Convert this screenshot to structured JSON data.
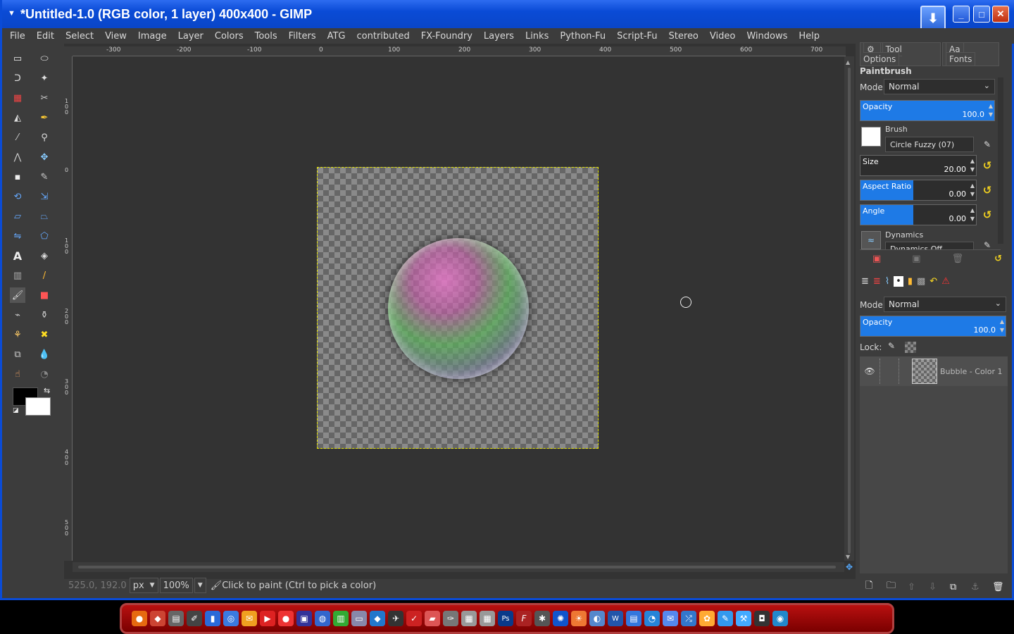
{
  "window": {
    "title": "*Untitled-1.0 (RGB color, 1 layer) 400x400 - GIMP",
    "minimize_glyph": "_",
    "maximize_glyph": "□",
    "close_glyph": "✕"
  },
  "menubar": [
    "File",
    "Edit",
    "Select",
    "View",
    "Image",
    "Layer",
    "Colors",
    "Tools",
    "Filters",
    "ATG",
    "contributed",
    "FX-Foundry",
    "Layers",
    "Links",
    "Python-Fu",
    "Script-Fu",
    "Stereo",
    "Video",
    "Windows",
    "Help"
  ],
  "ruler": {
    "h_ticks": [
      "-300",
      "-200",
      "-100",
      "0",
      "100",
      "200",
      "300",
      "400",
      "500",
      "600",
      "700"
    ],
    "v_ticks": [
      "100",
      "0",
      "100",
      "200",
      "300",
      "400",
      "500"
    ]
  },
  "statusbar": {
    "coords": "525.0, 192.0",
    "unit": "px",
    "zoom": "100",
    "zoom_suffix": "%",
    "message": "Click to paint (Ctrl to pick a color)"
  },
  "tool_options": {
    "tab_tool_options": "Tool Options",
    "tab_fonts": "Fonts",
    "tool_name": "Paintbrush",
    "mode_label": "Mode:",
    "mode_value": "Normal",
    "opacity_label": "Opacity",
    "opacity_value": "100.0",
    "opacity_fraction": 1.0,
    "brush_label": "Brush",
    "brush_value": "Circle Fuzzy (07)",
    "size_label": "Size",
    "size_value": "20.00",
    "aspect_label": "Aspect Ratio",
    "aspect_value": "0.00",
    "angle_label": "Angle",
    "angle_value": "0.00",
    "dynamics_label": "Dynamics",
    "dynamics_value": "Dynamics Off"
  },
  "layers": {
    "mode_label": "Mode:",
    "mode_value": "Normal",
    "opacity_label": "Opacity",
    "opacity_value": "100.0",
    "lock_label": "Lock:",
    "items": [
      {
        "name": "Bubble - Color 1"
      }
    ]
  },
  "colors": {
    "title_blue": "#0a4bd6",
    "accent": "#1e7ae6",
    "selection": "#e8e800",
    "taskbar": "#9a0000"
  }
}
